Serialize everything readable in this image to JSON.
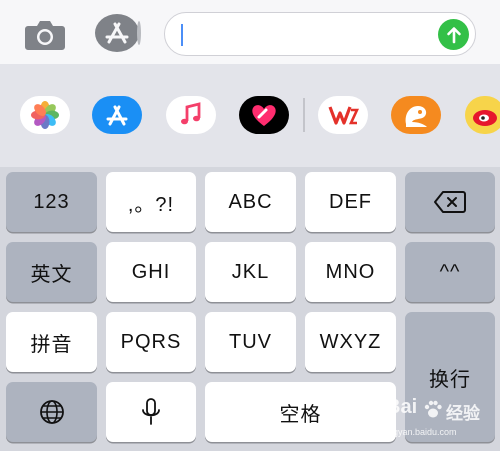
{
  "message_input": {
    "value": ""
  },
  "keyboard": {
    "keys": {
      "numbers": "123",
      "punct": ",。?!",
      "abc": "ABC",
      "def": "DEF",
      "english": "英文",
      "ghi": "GHI",
      "jkl": "JKL",
      "mno": "MNO",
      "emoticon": "^^",
      "pinyin": "拼音",
      "pqrs": "PQRS",
      "tuv": "TUV",
      "wxyz": "WXYZ",
      "return": "换行",
      "space": "空格"
    }
  },
  "watermark": {
    "brand": "Bai",
    "brand2": "经验",
    "url": "jingyan.baidu.com"
  },
  "colors": {
    "send": "#33c047",
    "key_dark": "#adb3bf",
    "key_light": "#ffffff"
  }
}
